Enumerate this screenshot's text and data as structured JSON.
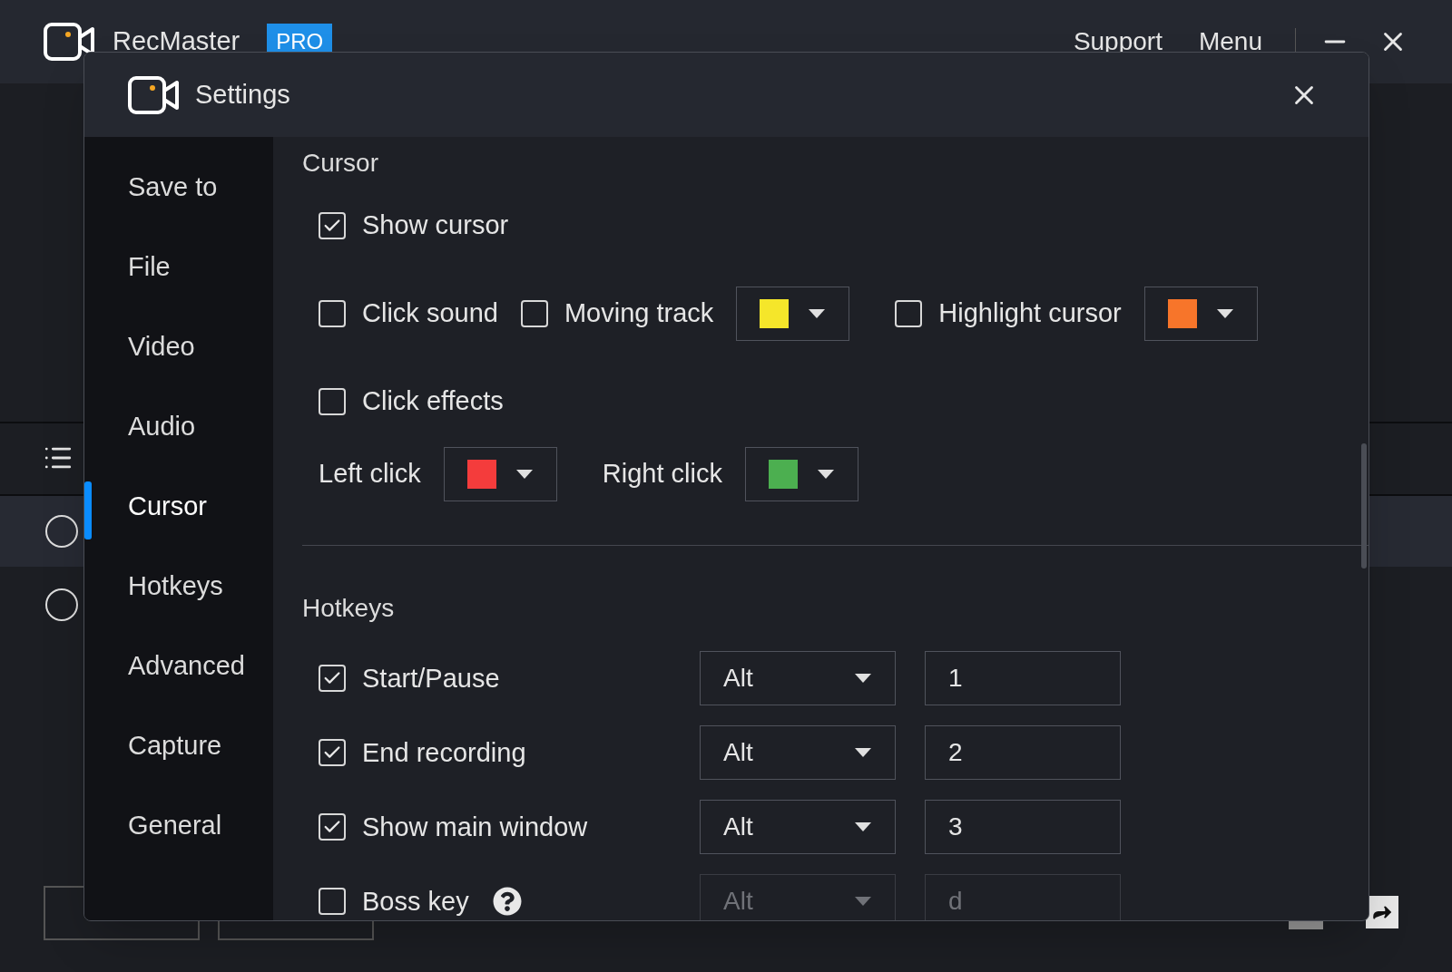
{
  "app": {
    "title": "RecMaster",
    "badge": "PRO",
    "menu": [
      "Support",
      "Menu"
    ]
  },
  "dialog": {
    "title": "Settings",
    "sidebar": [
      {
        "label": "Save to",
        "selected": false
      },
      {
        "label": "File",
        "selected": false
      },
      {
        "label": "Video",
        "selected": false
      },
      {
        "label": "Audio",
        "selected": false
      },
      {
        "label": "Cursor",
        "selected": true
      },
      {
        "label": "Hotkeys",
        "selected": false
      },
      {
        "label": "Advanced",
        "selected": false
      },
      {
        "label": "Capture",
        "selected": false
      },
      {
        "label": "General",
        "selected": false
      }
    ],
    "cursor": {
      "title": "Cursor",
      "rows": [
        [
          {
            "kind": "checkbox",
            "label": "Show cursor",
            "checked": true
          }
        ],
        [
          {
            "kind": "checkbox",
            "label": "Click sound",
            "checked": false
          },
          {
            "kind": "checkbox",
            "label": "Moving track",
            "checked": false
          },
          {
            "kind": "color",
            "color": "#f5e62a"
          },
          {
            "kind": "checkbox",
            "label": "Highlight cursor",
            "checked": false
          },
          {
            "kind": "color",
            "color": "#f7752a"
          }
        ],
        [
          {
            "kind": "checkbox",
            "label": "Click effects",
            "checked": false
          }
        ],
        [
          {
            "kind": "label",
            "label": "Left click"
          },
          {
            "kind": "color",
            "color": "#f43c3c"
          },
          {
            "kind": "label",
            "label": "Right click"
          },
          {
            "kind": "color",
            "color": "#4caf50"
          }
        ]
      ]
    },
    "hotkeys": {
      "title": "Hotkeys",
      "rows": [
        {
          "label": "Start/Pause",
          "checked": true,
          "modifier": "Alt",
          "key": "1",
          "disabled": false,
          "help": false
        },
        {
          "label": "End recording",
          "checked": true,
          "modifier": "Alt",
          "key": "2",
          "disabled": false,
          "help": false
        },
        {
          "label": "Show main window",
          "checked": true,
          "modifier": "Alt",
          "key": "3",
          "disabled": false,
          "help": false
        },
        {
          "label": "Boss key",
          "checked": false,
          "modifier": "Alt",
          "key": "d",
          "disabled": true,
          "help": true
        }
      ]
    }
  }
}
